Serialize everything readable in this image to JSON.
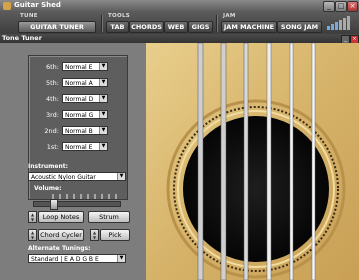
{
  "window": {
    "title": "Guitar Shed"
  },
  "toolbar": {
    "tune_group": "TUNE",
    "tools_group": "TOOLS",
    "jam_group": "JAM",
    "guitar_tuner": "GUITAR TUNER",
    "tab": "TAB",
    "chords": "CHORDS",
    "web": "WEB",
    "gigs": "GIGS",
    "jam_machine": "JAM MACHINE",
    "song_jam": "SONG JAM"
  },
  "panel": {
    "title": "Tone Tuner"
  },
  "strings": [
    {
      "label": "6th:",
      "value": "Normal E"
    },
    {
      "label": "5th:",
      "value": "Normal A"
    },
    {
      "label": "4th:",
      "value": "Normal D"
    },
    {
      "label": "3rd:",
      "value": "Normal G"
    },
    {
      "label": "2nd:",
      "value": "Normal B"
    },
    {
      "label": "1st:",
      "value": "Normal E"
    }
  ],
  "instrument": {
    "label": "Instrument:",
    "value": "Acoustic Nylon Guitar"
  },
  "volume": {
    "label": "Volume:",
    "level": 0.2
  },
  "buttons": {
    "loop_notes": "Loop Notes",
    "strum": "Strum",
    "chord_cycler": "Chord Cycler",
    "pick": "Pick"
  },
  "tunings": {
    "label": "Alternate Tunings:",
    "value": "Standard | E A D G B E"
  },
  "colors": {
    "guitar_body": "#d9b870",
    "soundhole": "#141414",
    "window_bg": "#6b6b6b"
  }
}
